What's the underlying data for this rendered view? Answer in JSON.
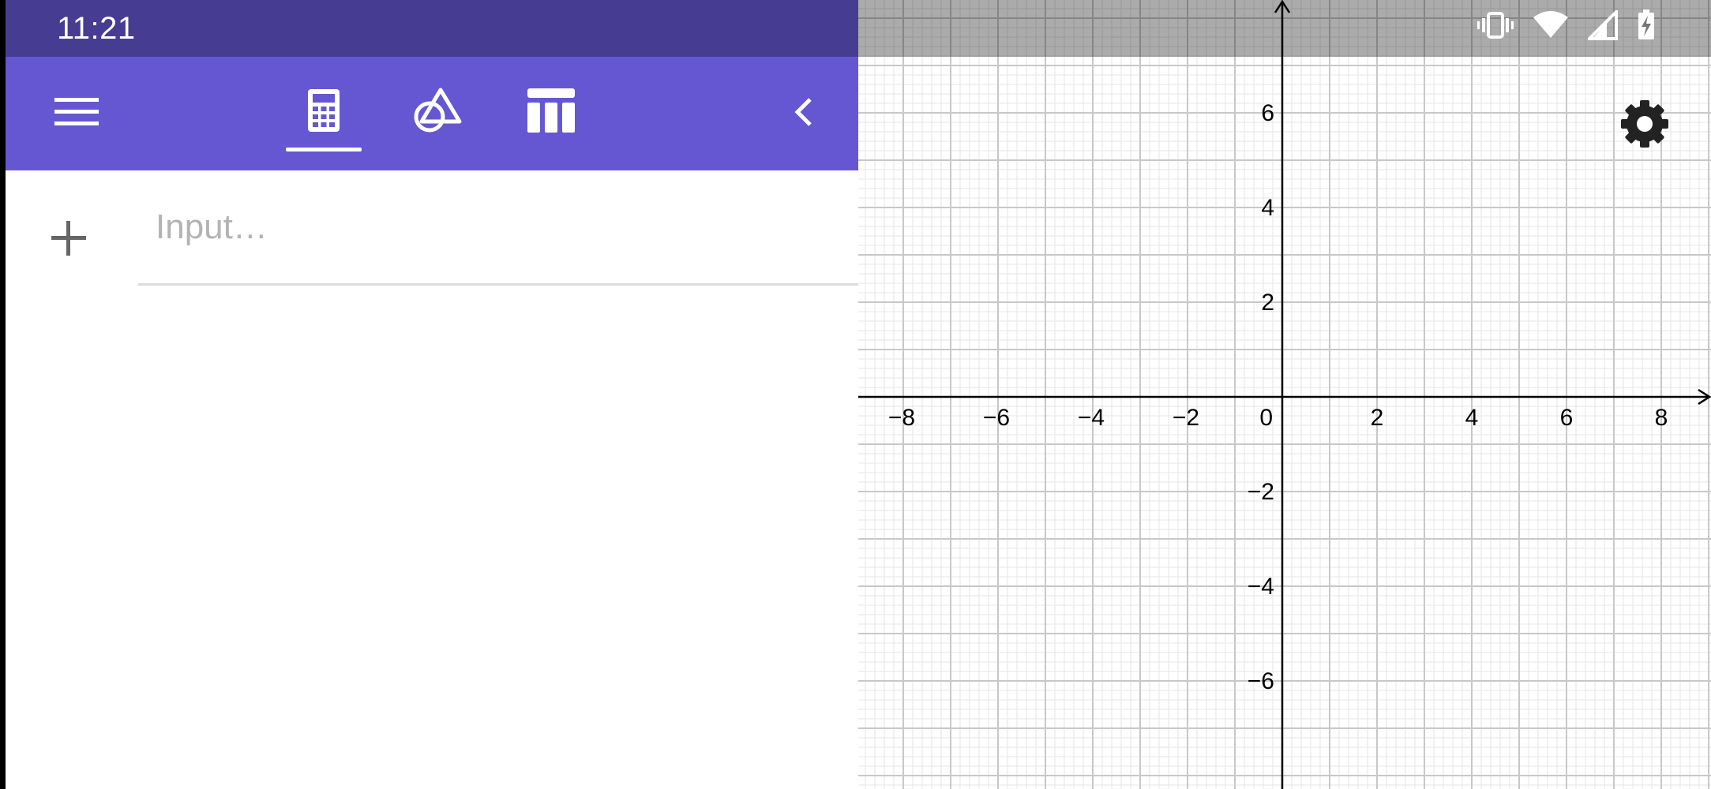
{
  "status_bar": {
    "time": "11:21",
    "icons": [
      "vibrate-icon",
      "wifi-icon",
      "cell-signal-icon",
      "battery-charging-icon"
    ]
  },
  "toolbar": {
    "menu_icon": "hamburger-menu-icon",
    "tabs": [
      {
        "name": "algebra",
        "icon": "calculator-icon",
        "selected": true
      },
      {
        "name": "tools",
        "icon": "shapes-icon",
        "selected": false
      },
      {
        "name": "table",
        "icon": "table-icon",
        "selected": false
      }
    ],
    "collapse_icon": "chevron-left-icon"
  },
  "algebra": {
    "add_icon": "plus-icon",
    "input_placeholder": "Input…",
    "input_value": ""
  },
  "graph": {
    "x_ticks": [
      "−8",
      "−6",
      "−4",
      "−2",
      "0",
      "2",
      "4",
      "6",
      "8"
    ],
    "y_ticks": [
      "6",
      "4",
      "2",
      "−2",
      "−4",
      "−6"
    ],
    "settings_icon": "gear-icon"
  },
  "colors": {
    "status_bar": "#463d93",
    "toolbar": "#6557d2",
    "grid_major": "#c8c8c8",
    "grid_minor": "#e6e6e6",
    "axis": "#000000"
  }
}
